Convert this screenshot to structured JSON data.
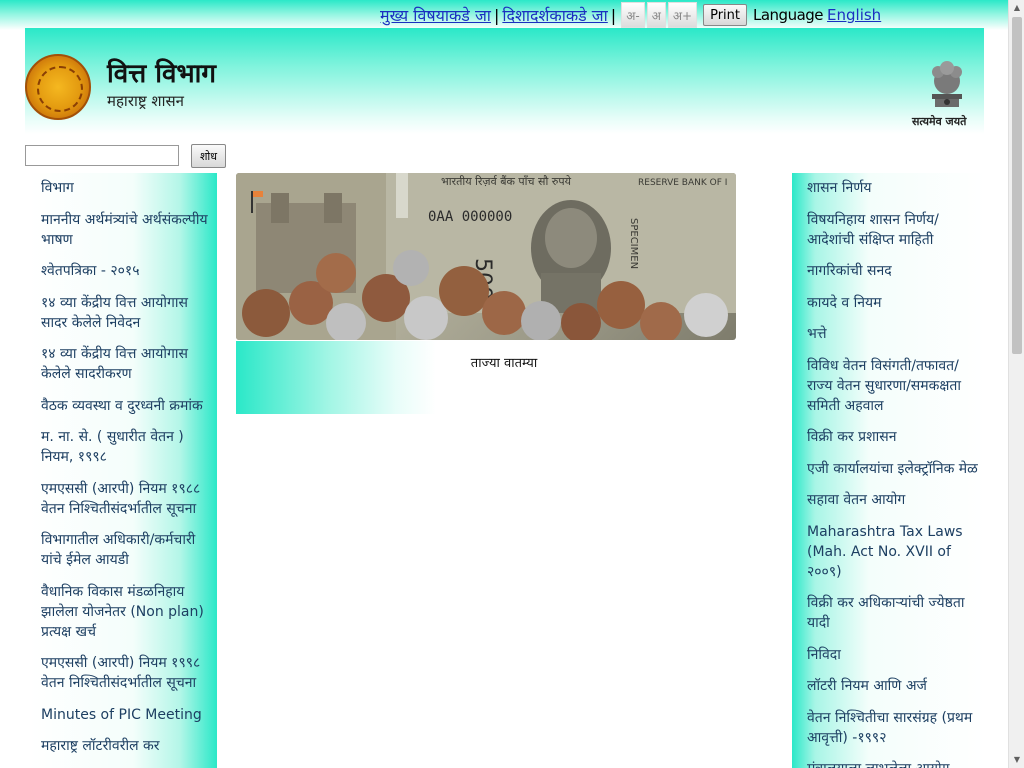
{
  "top_bar": {
    "main_content_link": "मुख्य विषयाकडे जा",
    "nav_link": "दिशादर्शकाकडे जा",
    "sep": "|",
    "font_decrease": "अ-",
    "font_normal": "अ",
    "font_increase": "अ+",
    "print_label": "Print",
    "language_label": "Language",
    "language_link": "English"
  },
  "header": {
    "title": "वित्त विभाग",
    "subtitle": "महाराष्ट्र शासन",
    "emblem_caption": "सत्यमेव जयते"
  },
  "search": {
    "value": "",
    "button_label": "शोध"
  },
  "left_menu": [
    "विभाग",
    "माननीय अर्थमंत्र्यांचे अर्थसंकल्पीय भाषण",
    "श्वेतपत्रिका - २०१५",
    "१४ व्या केंद्रीय वित्त आयोगास सादर केलेले निवेदन",
    "१४ व्या केंद्रीय वित्त आयोगास केलेले सादरीकरण",
    "वैठक व्यवस्था व दुरध्वनी क्रमांक",
    "म. ना. से. ( सुधारीत वेतन ) नियम, १९९८",
    "एमएससी (आरपी) नियम १९८८ वेतन निश्चितीसंदर्भातील सूचना",
    "विभागातील अधिकारी/कर्मचारी यांचे ईमेल आयडी",
    "वैधानिक विकास मंडळनिहाय झालेला योजनेतर (Non plan) प्रत्यक्ष खर्च",
    "एमएससी (आरपी) नियम १९९८ वेतन निश्चितीसंदर्भातील सूचना",
    "Minutes of PIC Meeting",
    "महाराष्ट्र लॉटरीवरील कर"
  ],
  "right_menu": [
    "शासन निर्णय",
    "विषयनिहाय शासन निर्णय/ आदेशांची संक्षिप्त माहिती",
    "नागरिकांची सनद",
    "कायदे व नियम",
    "भत्ते",
    "विविध वेतन विसंगती/तफावत/ राज्य वेतन सुधारणा/समकक्षता समिती अहवाल",
    "विक्री कर प्रशासन",
    "एजी कार्यालयांचा इलेक्ट्रॉनिक मेळ",
    "सहावा वेतन आयोग",
    "Maharashtra Tax Laws (Mah. Act No. XVII of २००९)",
    "विक्री कर अधिकाऱ्यांची ज्येष्ठता यादी",
    "निविदा",
    "लॉटरी नियम आणि अर्ज",
    "वेतन निश्चितीचा सारसंग्रह (प्रथम आवृत्ती) -१९९२",
    "मंत्रालयाला लाभलेला आयोग"
  ],
  "banner": {
    "note_top": "भारतीय रिज़र्व बैंक  पाँच सौ रुपये",
    "note_right": "RESERVE BANK OF I",
    "serial": "0AA 000000",
    "specimen": "SPECIMEN",
    "denomination": "500"
  },
  "news": {
    "title": "ताज्या वातम्या"
  },
  "colors": {
    "accent": "#2ae8c8",
    "link": "#1a2fc0",
    "menu_text": "#1d3f62"
  }
}
